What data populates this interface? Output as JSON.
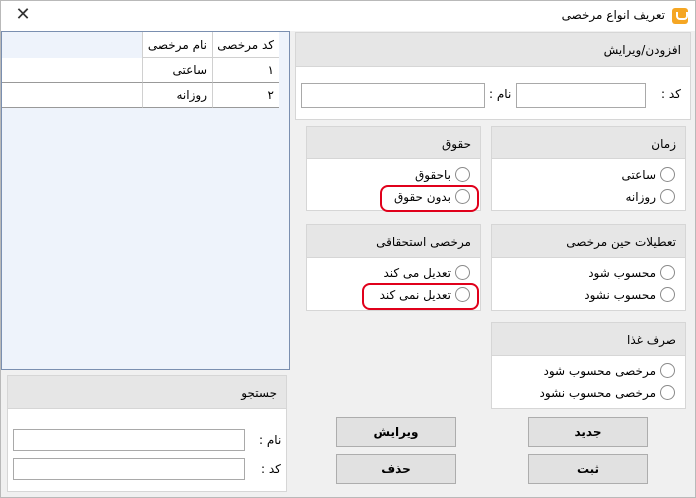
{
  "window": {
    "title": "تعریف انواع مرخصی",
    "close_glyph": "✕",
    "icon": "app-icon"
  },
  "grid": {
    "columns": [
      "کد مرخصی",
      "نام مرخصی"
    ],
    "rows": [
      {
        "code": "۱",
        "name": "ساعتی"
      },
      {
        "code": "۲",
        "name": "روزانه"
      }
    ]
  },
  "editor": {
    "title": "افزودن/ویرایش",
    "code_label": "کد :",
    "name_label": "نام :",
    "code_value": "",
    "name_value": ""
  },
  "time_group": {
    "title": "زمان",
    "options": [
      "ساعتی",
      "روزانه"
    ]
  },
  "salary_group": {
    "title": "حقوق",
    "options": [
      "باحقوق",
      "بدون حقوق"
    ]
  },
  "holidays_group": {
    "title": "تعطیلات حین مرخصی",
    "options": [
      "محسوب شود",
      "محسوب نشود"
    ]
  },
  "entitlement_group": {
    "title": "مرخصی استحقاقی",
    "options": [
      "تعدیل می کند",
      "تعدیل نمی کند"
    ]
  },
  "meal_group": {
    "title": "صرف غذا",
    "options": [
      "مرخصی محسوب شود",
      "مرخصی محسوب نشود"
    ]
  },
  "search": {
    "title": "جستجو",
    "name_label": "نام :",
    "code_label": "کد :",
    "name_value": "",
    "code_value": ""
  },
  "buttons": {
    "new": "جدید",
    "edit": "ویرایش",
    "save": "ثبت",
    "delete": "حذف"
  },
  "colors": {
    "highlight": "#e0001b",
    "grid_bg": "#eef3fb",
    "app_icon": "#f5a623"
  }
}
